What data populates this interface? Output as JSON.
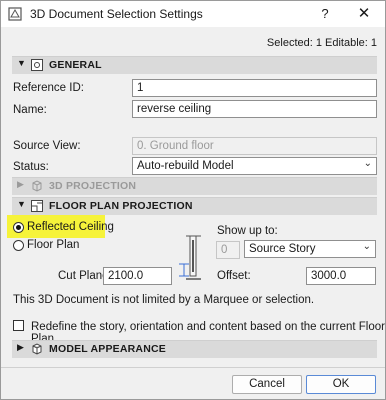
{
  "window": {
    "title": "3D Document Selection Settings",
    "help": "?",
    "close": "✕"
  },
  "selection_info": "Selected: 1 Editable: 1",
  "general": {
    "header": "GENERAL",
    "reference_id_label": "Reference ID:",
    "reference_id_value": "1",
    "name_label": "Name:",
    "name_value": "reverse ceiling",
    "source_view_label": "Source View:",
    "source_view_value": "0. Ground floor",
    "status_label": "Status:",
    "status_value": "Auto-rebuild Model"
  },
  "projection_3d": {
    "header": "3D PROJECTION"
  },
  "floor_plan_projection": {
    "header": "FLOOR PLAN PROJECTION",
    "option_reflected": "Reflected Ceiling",
    "option_floor_plan": "Floor Plan",
    "selected_option": "Reflected Ceiling",
    "show_up_to_label": "Show up to:",
    "show_up_to_number": "0",
    "show_up_to_value": "Source Story",
    "cut_plane_label": "Cut Plane:",
    "cut_plane_value": "2100.0",
    "offset_label": "Offset:",
    "offset_value": "3000.0",
    "marquee_note": "This 3D Document is not limited by a Marquee or selection.",
    "redefine_label": "Redefine the story, orientation and content based on the current Floor Plan.",
    "redefine_checked": false
  },
  "model_appearance": {
    "header": "MODEL APPEARANCE"
  },
  "buttons": {
    "cancel": "Cancel",
    "ok": "OK"
  },
  "colors": {
    "highlight": "#f6f33a",
    "ok_border": "#5a8ad6"
  }
}
